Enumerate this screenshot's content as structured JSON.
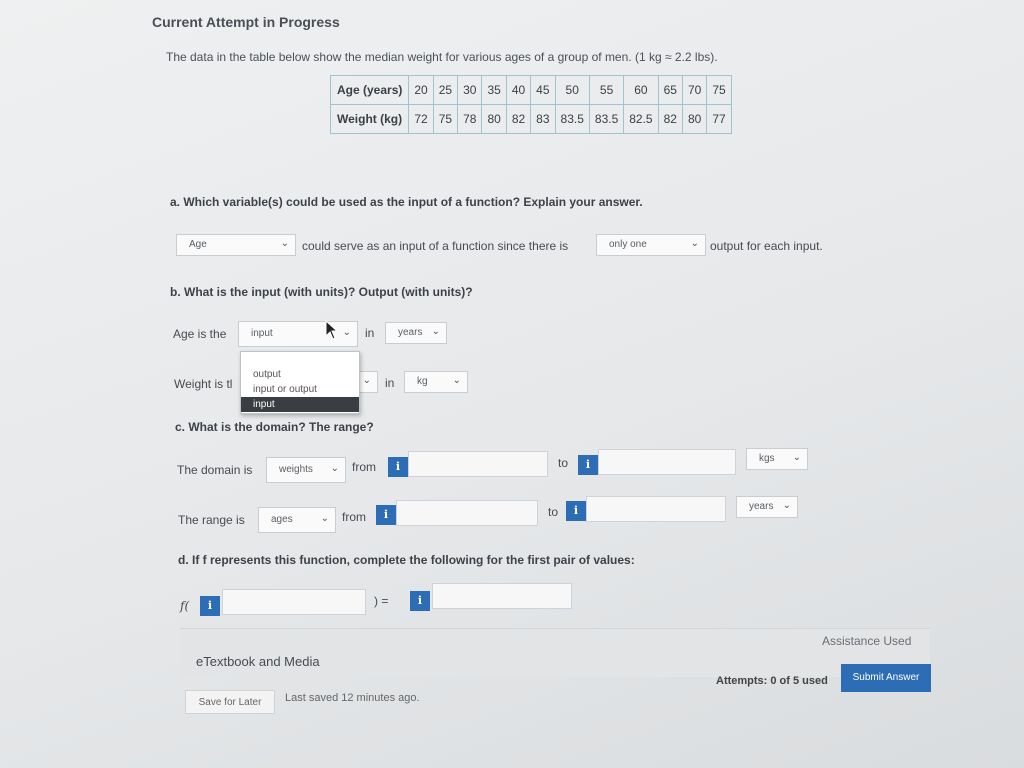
{
  "header": {
    "title": "Current Attempt in Progress"
  },
  "intro": {
    "text": "The data in the table below show the median weight for various ages of a group of men. (1 kg ≈ 2.2 lbs)."
  },
  "table": {
    "row_labels": [
      "Age (years)",
      "Weight (kg)"
    ],
    "ages": [
      "20",
      "25",
      "30",
      "35",
      "40",
      "45",
      "50",
      "55",
      "60",
      "65",
      "70",
      "75"
    ],
    "weights": [
      "72",
      "75",
      "78",
      "80",
      "82",
      "83",
      "83.5",
      "83.5",
      "82.5",
      "82",
      "80",
      "77"
    ]
  },
  "part_a": {
    "question": "a. Which variable(s) could be used as the input of a function? Explain your answer.",
    "select1": "Age",
    "middle_text": "could serve as an input of a function since there is",
    "select2": "only one",
    "end_text": "output for each input."
  },
  "part_b": {
    "question": "b. What is the input (with units)? Output (with units)?",
    "row1_prefix": "Age is the",
    "row1_select": "input",
    "row1_in": "in",
    "row1_unit": "years",
    "row2_prefix": "Weight is tl",
    "row2_in": "in",
    "row2_unit": "kg",
    "dropdown_options": [
      "output",
      "input or output",
      "input"
    ]
  },
  "part_c": {
    "question": "c. What is the domain? The range?",
    "domain_prefix": "The domain is",
    "domain_select": "weights",
    "domain_from": "from",
    "domain_to": "to",
    "domain_unit": "kgs",
    "range_prefix": "The range is",
    "range_select": "ages",
    "range_from": "from",
    "range_to": "to",
    "range_unit": "years"
  },
  "part_d": {
    "question": "d. If f represents this function, complete the following for the first pair of values:",
    "f_open": "f(",
    "close_eq": ") ="
  },
  "info_glyph": "i",
  "footer": {
    "etextbook": "eTextbook and Media",
    "assistance": "Assistance Used",
    "save_label": "Save for Later",
    "saved_status": "Last saved 12 minutes ago.",
    "attempts": "Attempts: 0 of 5 used",
    "submit_label": "Submit Answer"
  },
  "colors": {
    "accent": "#2d6db5",
    "table_border": "#9fc3cf"
  }
}
